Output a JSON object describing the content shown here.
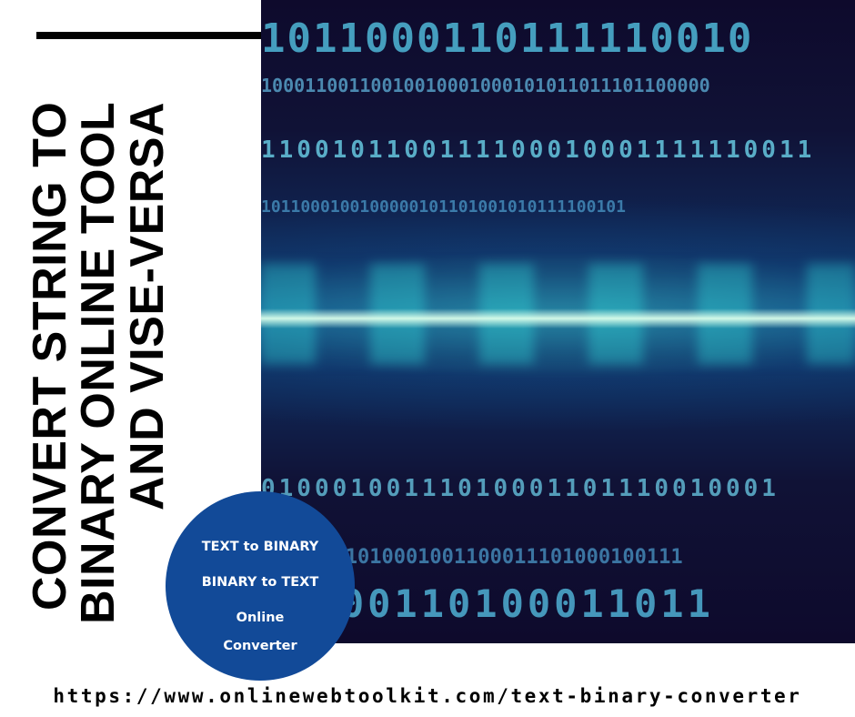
{
  "title": {
    "lines": [
      "CONVERT STRING TO",
      "BINARY ONLINE TOOL",
      "AND VISE-VERSA"
    ]
  },
  "badge": {
    "line1": "TEXT to BINARY",
    "line2": "BINARY to TEXT",
    "line3": "Online",
    "line4": "Converter",
    "color": "#124a98"
  },
  "url": "https://www.onlinewebtoolkit.com/text-binary-converter",
  "hero": {
    "description": "binary code background",
    "rows": [
      "1011000110111110010",
      "10001100110010010001000101011011101100000",
      "1100101100111100010001111110011",
      "1011000100100000101101001010111100101",
      "01000100111010001101110010001",
      "11110011010001001100011101000100111",
      "00000110100011011"
    ]
  },
  "colors": {
    "background": "#ffffff",
    "text": "#000000",
    "hero_dark": "#0e0a2c",
    "hero_glow": "#3cc8c8"
  }
}
